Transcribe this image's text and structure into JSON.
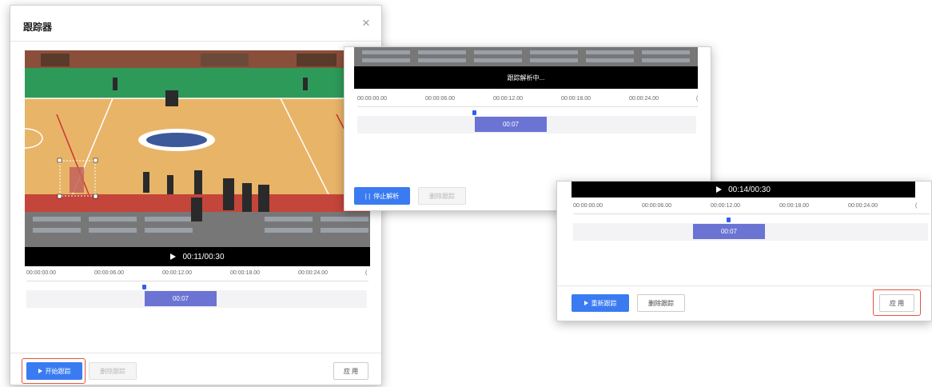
{
  "main": {
    "title": "跟踪器",
    "close_symbol": "×",
    "video": {
      "time": "00:11/00:30"
    },
    "ticks": [
      "00:00:00.00",
      "00:00:06.00",
      "00:00:12.00",
      "00:00:18.00",
      "00:00:24.00",
      "("
    ],
    "segment_label": "00:07",
    "buttons": {
      "start": "开始跟踪",
      "delete": "删除跟踪",
      "apply": "应 用"
    }
  },
  "second": {
    "status": "跟踪解析中...",
    "ticks": [
      "00:00:00.00",
      "00:00:06.00",
      "00:00:12.00",
      "00:00:18.00",
      "00:00:24.00",
      "("
    ],
    "segment_label": "00:07",
    "buttons": {
      "pause_symbol": "| |",
      "stop": "停止解析",
      "delete": "删除跟踪"
    }
  },
  "third": {
    "video": {
      "time": "00:14/00:30"
    },
    "ticks": [
      "00:00:00.00",
      "00:00:06.00",
      "00:00:12.00",
      "00:00:18.00",
      "00:00:24.00",
      "("
    ],
    "segment_label": "00:07",
    "buttons": {
      "retrack": "重新跟踪",
      "delete": "删除跟踪",
      "apply": "应 用"
    }
  },
  "colors": {
    "primary": "#3a7bf2",
    "segment": "#6b73d3",
    "highlight": "#e2553e",
    "court_floor": "#e8b468",
    "court_green": "#2e9a5a"
  }
}
